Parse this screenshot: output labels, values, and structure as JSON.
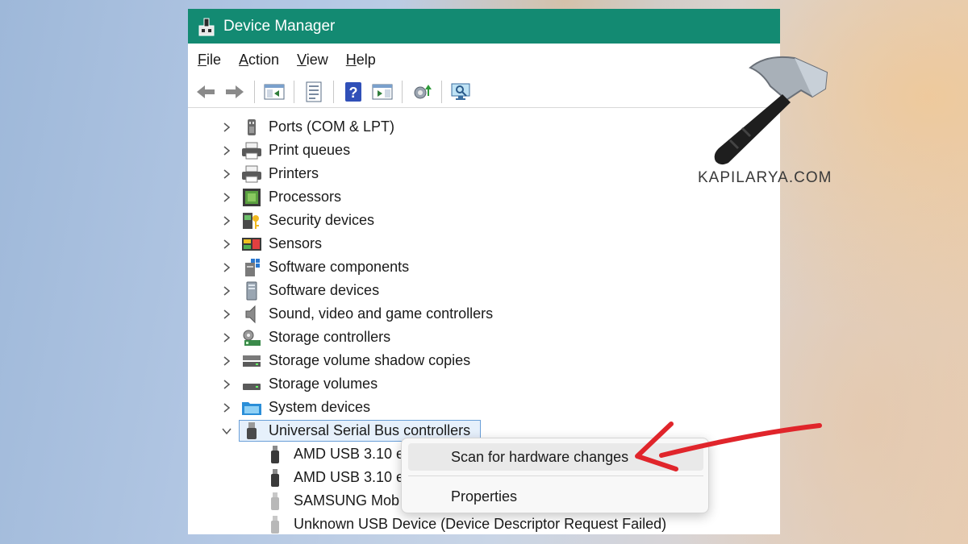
{
  "window": {
    "title": "Device Manager",
    "titlebar_color": "#138a72"
  },
  "menu": [
    {
      "label": "File",
      "ul": "F",
      "rest": "ile"
    },
    {
      "label": "Action",
      "ul": "A",
      "rest": "ction"
    },
    {
      "label": "View",
      "ul": "V",
      "rest": "iew"
    },
    {
      "label": "Help",
      "ul": "H",
      "rest": "elp"
    }
  ],
  "toolbar": {
    "icons": [
      "back-arrow-icon",
      "forward-arrow-icon",
      "show-hide-console-tree-icon",
      "properties-icon",
      "help-icon",
      "action-pane-icon",
      "update-driver-icon",
      "scan-hardware-icon"
    ]
  },
  "tree": {
    "categories": [
      {
        "label": "Ports (COM & LPT)",
        "icon": "port-icon"
      },
      {
        "label": "Print queues",
        "icon": "printer-icon"
      },
      {
        "label": "Printers",
        "icon": "printer-icon"
      },
      {
        "label": "Processors",
        "icon": "processor-icon"
      },
      {
        "label": "Security devices",
        "icon": "security-key-icon"
      },
      {
        "label": "Sensors",
        "icon": "sensor-icon"
      },
      {
        "label": "Software components",
        "icon": "software-component-icon"
      },
      {
        "label": "Software devices",
        "icon": "software-device-icon"
      },
      {
        "label": "Sound, video and game controllers",
        "icon": "speaker-icon"
      },
      {
        "label": "Storage controllers",
        "icon": "storage-controller-icon"
      },
      {
        "label": "Storage volume shadow copies",
        "icon": "drive-icon"
      },
      {
        "label": "Storage volumes",
        "icon": "drive-icon"
      },
      {
        "label": "System devices",
        "icon": "system-folder-icon"
      }
    ],
    "expanded": {
      "label": "Universal Serial Bus controllers",
      "icon": "usb-icon"
    },
    "children": [
      {
        "label": "AMD USB 3.10 e",
        "icon": "usb-plug-icon"
      },
      {
        "label": "AMD USB 3.10 e",
        "icon": "usb-plug-icon"
      },
      {
        "label": "SAMSUNG Mob",
        "icon": "usb-plug-icon"
      },
      {
        "label": "Unknown USB Device (Device Descriptor Request Failed)",
        "icon": "usb-plug-icon"
      }
    ]
  },
  "context_menu": {
    "scan_label": "Scan for hardware changes",
    "properties_label": "Properties"
  },
  "watermark": {
    "text": "KAPILARYA.COM"
  },
  "annotation": {
    "arrow_color": "#e0252b"
  }
}
